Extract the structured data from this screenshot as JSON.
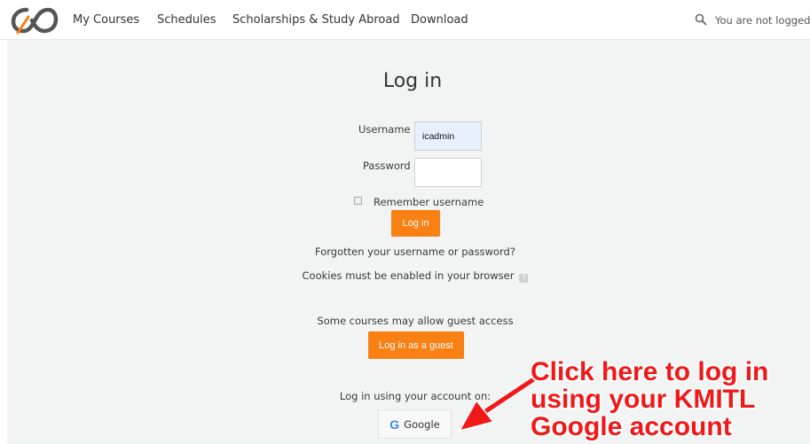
{
  "nav": {
    "links": [
      "My Courses",
      "Schedules",
      "Scholarships & Study Abroad",
      "Download"
    ],
    "login_status": "You are not logged in"
  },
  "login": {
    "title": "Log in",
    "username_label": "Username",
    "username_value": "icadmin",
    "password_label": "Password",
    "password_value": "",
    "remember_label": "Remember username",
    "login_button": "Log in",
    "forgot_link": "Forgotten your username or password?",
    "cookies_text": "Cookies must be enabled in your browser",
    "guest_text": "Some courses may allow guest access",
    "guest_button": "Log in as a guest",
    "account_text": "Log in using your account on:",
    "google_button": "Google"
  },
  "annotation": {
    "lines": [
      "Click here to log in",
      "using your KMITL",
      "Google account"
    ],
    "color": "#f01818"
  },
  "colors": {
    "accent": "#f98012",
    "background": "#f2f4f4"
  }
}
